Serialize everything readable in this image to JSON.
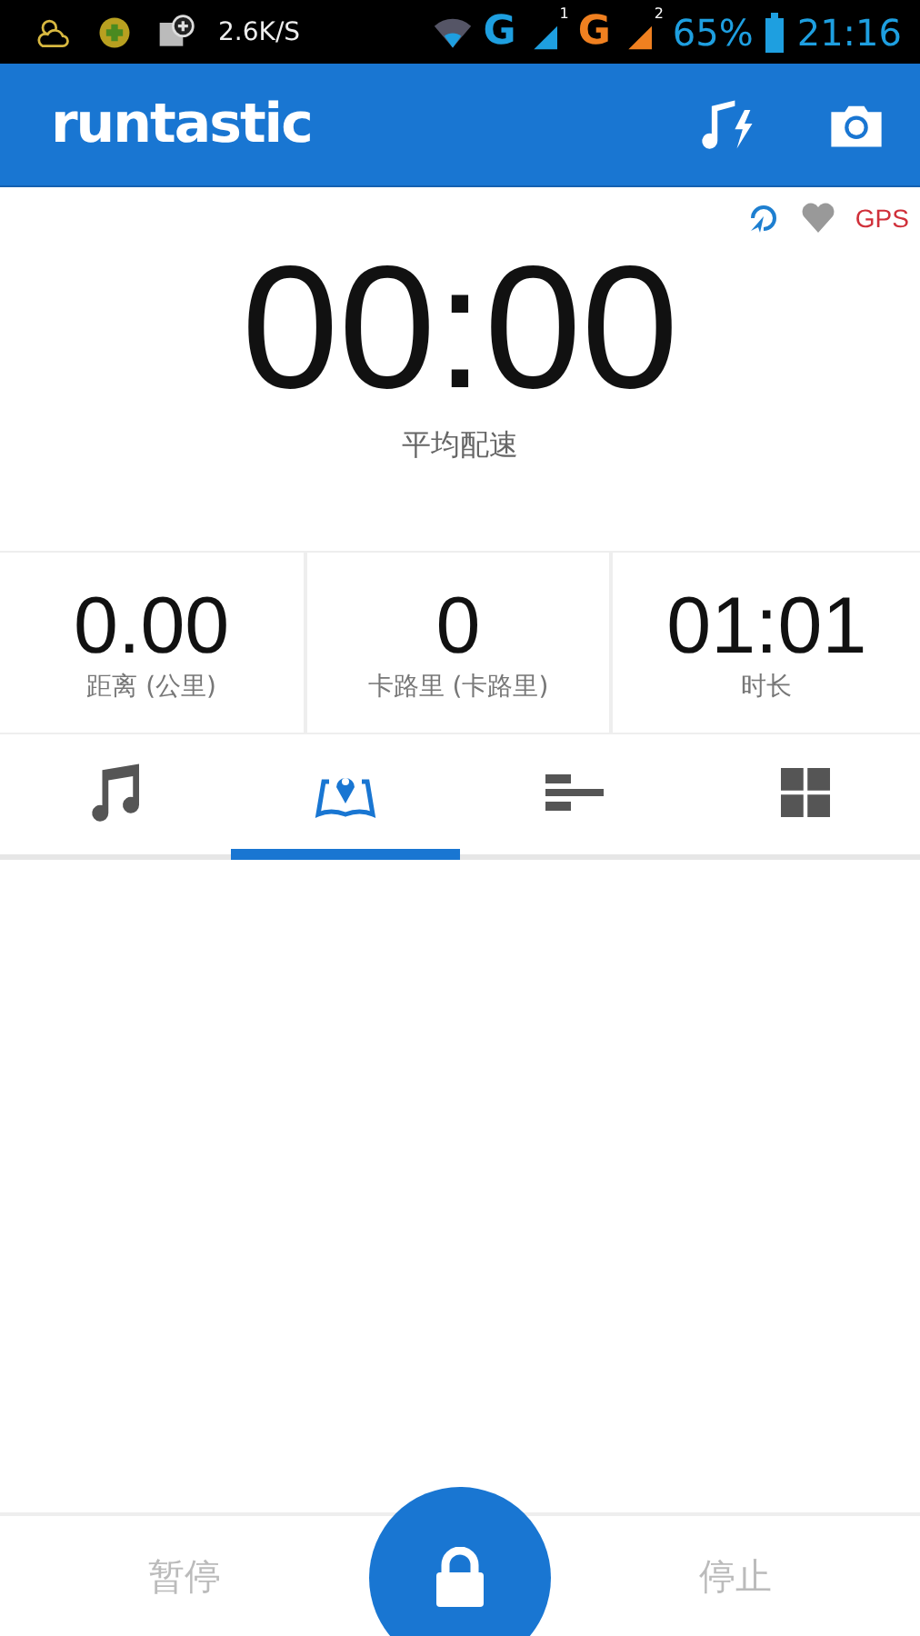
{
  "status_bar": {
    "net_speed": "2.6K/S",
    "carriers": [
      {
        "label": "G",
        "sim": "1",
        "color": "#1e9fe0"
      },
      {
        "label": "G",
        "sim": "2",
        "color": "#f08020"
      }
    ],
    "battery": "65%",
    "time": "21:16"
  },
  "app_bar": {
    "logo": "runtastic"
  },
  "indicators": {
    "gps": "GPS"
  },
  "timer": {
    "value": "00:00",
    "label": "平均配速"
  },
  "stats": [
    {
      "value": "0.00",
      "label": "距离 (公里)"
    },
    {
      "value": "0",
      "label": "卡路里 (卡路里)"
    },
    {
      "value": "01:01",
      "label": "时长"
    }
  ],
  "tabs": [
    {
      "kind": "music",
      "selected": false
    },
    {
      "kind": "map",
      "selected": true
    },
    {
      "kind": "bars",
      "selected": false
    },
    {
      "kind": "grid",
      "selected": false
    }
  ],
  "bottom_bar": {
    "pause": "暂停",
    "stop": "停止"
  }
}
